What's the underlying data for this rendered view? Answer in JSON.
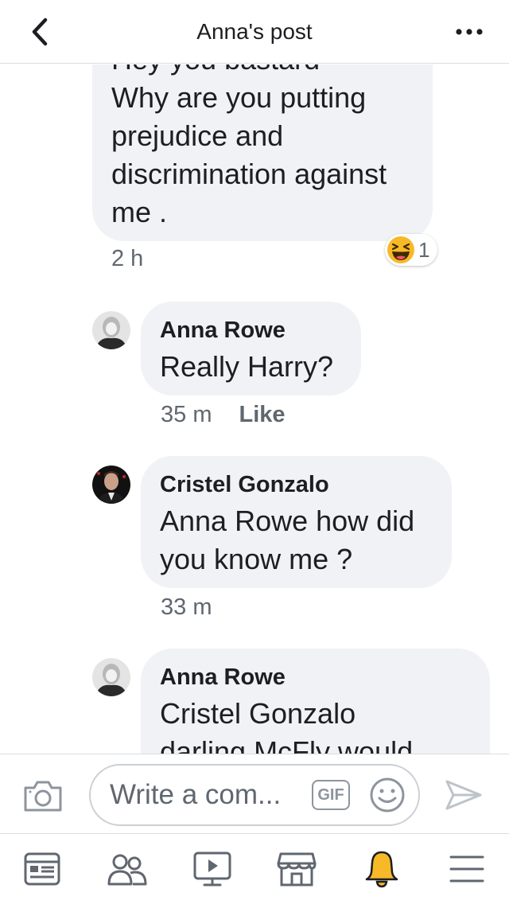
{
  "header": {
    "title": "Anna's post"
  },
  "comments": [
    {
      "clipped_first_line": "Hey you bastard",
      "lines": [
        "Why are you putting",
        "prejudice and",
        "discrimination against",
        "me ."
      ],
      "time": "2 h",
      "reaction": {
        "icon": "laughing-emoji-icon",
        "count": "1"
      }
    },
    {
      "author": "Anna Rowe",
      "lines": [
        "Really Harry?"
      ],
      "time": "35 m",
      "like_label": "Like"
    },
    {
      "author": "Cristel Gonzalo",
      "lines": [
        "Anna Rowe how did",
        "you know me ?"
      ],
      "time": "33 m"
    },
    {
      "author": "Anna Rowe",
      "lines": [
        "Cristel Gonzalo",
        "darling McFly would"
      ]
    }
  ],
  "composer": {
    "placeholder": "Write a com...",
    "gif_label": "GIF"
  },
  "tabs": [
    {
      "name": "news-feed",
      "icon": "news-feed-icon"
    },
    {
      "name": "friends",
      "icon": "friends-icon"
    },
    {
      "name": "watch",
      "icon": "watch-icon"
    },
    {
      "name": "marketplace",
      "icon": "marketplace-icon"
    },
    {
      "name": "notifications",
      "icon": "bell-icon",
      "active": true
    },
    {
      "name": "menu",
      "icon": "menu-icon"
    }
  ],
  "colors": {
    "bubble": "#f0f2f5",
    "text": "#1c1e21",
    "secondary": "#606770",
    "icon": "#606770",
    "active_bell": "#f7b928"
  }
}
